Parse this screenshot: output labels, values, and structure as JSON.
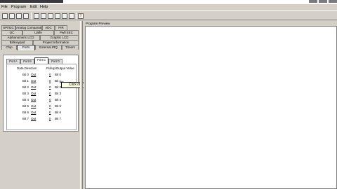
{
  "menubar": {
    "items": [
      {
        "label": "File"
      },
      {
        "label": "Program"
      },
      {
        "label": "Edit"
      },
      {
        "label": "Help"
      }
    ]
  },
  "toolbar": {
    "help_icon": "?"
  },
  "left": {
    "tab_rows": [
      [
        "SPI/I2C",
        "Analog Comparator",
        "ADC",
        "PIR"
      ],
      [
        "I2C",
        "Uaffe",
        "Pwfl EEC"
      ],
      [
        "Alphanumeric LCD",
        "Graphic LCD"
      ],
      [
        "Bit/Keypad",
        "Project Information"
      ],
      [
        "Chip",
        "Ports",
        "External IRQ",
        "Timers"
      ]
    ],
    "active_tab": "Ports",
    "subtabs": [
      "Port A",
      "Port B",
      "Port C",
      "Port D"
    ],
    "active_subtab": "Port C",
    "col_dir": "Data Direction",
    "col_pull": "Pullup/Output Value",
    "bits": [
      {
        "label": "Bit 0",
        "dir": "Out",
        "pv": "0",
        "plabel": "Bit 0"
      },
      {
        "label": "Bit 1",
        "dir": "Out",
        "pv": "0",
        "plabel": "Bit 1"
      },
      {
        "label": "Bit 2",
        "dir": "Out",
        "pv": "0",
        "plabel": "Bit 2"
      },
      {
        "label": "Bit 3",
        "dir": "Out",
        "pv": "0",
        "plabel": "Bit 3"
      },
      {
        "label": "Bit 4",
        "dir": "Out",
        "pv": "0",
        "plabel": "Bit 4"
      },
      {
        "label": "Bit 5",
        "dir": "Out",
        "pv": "0",
        "plabel": "Bit 5"
      },
      {
        "label": "Bit 6",
        "dir": "Out",
        "pv": "0",
        "plabel": "Bit 6"
      },
      {
        "label": "Bit 7",
        "dir": "Out",
        "pv": "0",
        "plabel": "Bit 7"
      }
    ],
    "tooltip": "Click on bit to toggle state"
  },
  "right": {
    "preview_label": "Program Preview"
  }
}
